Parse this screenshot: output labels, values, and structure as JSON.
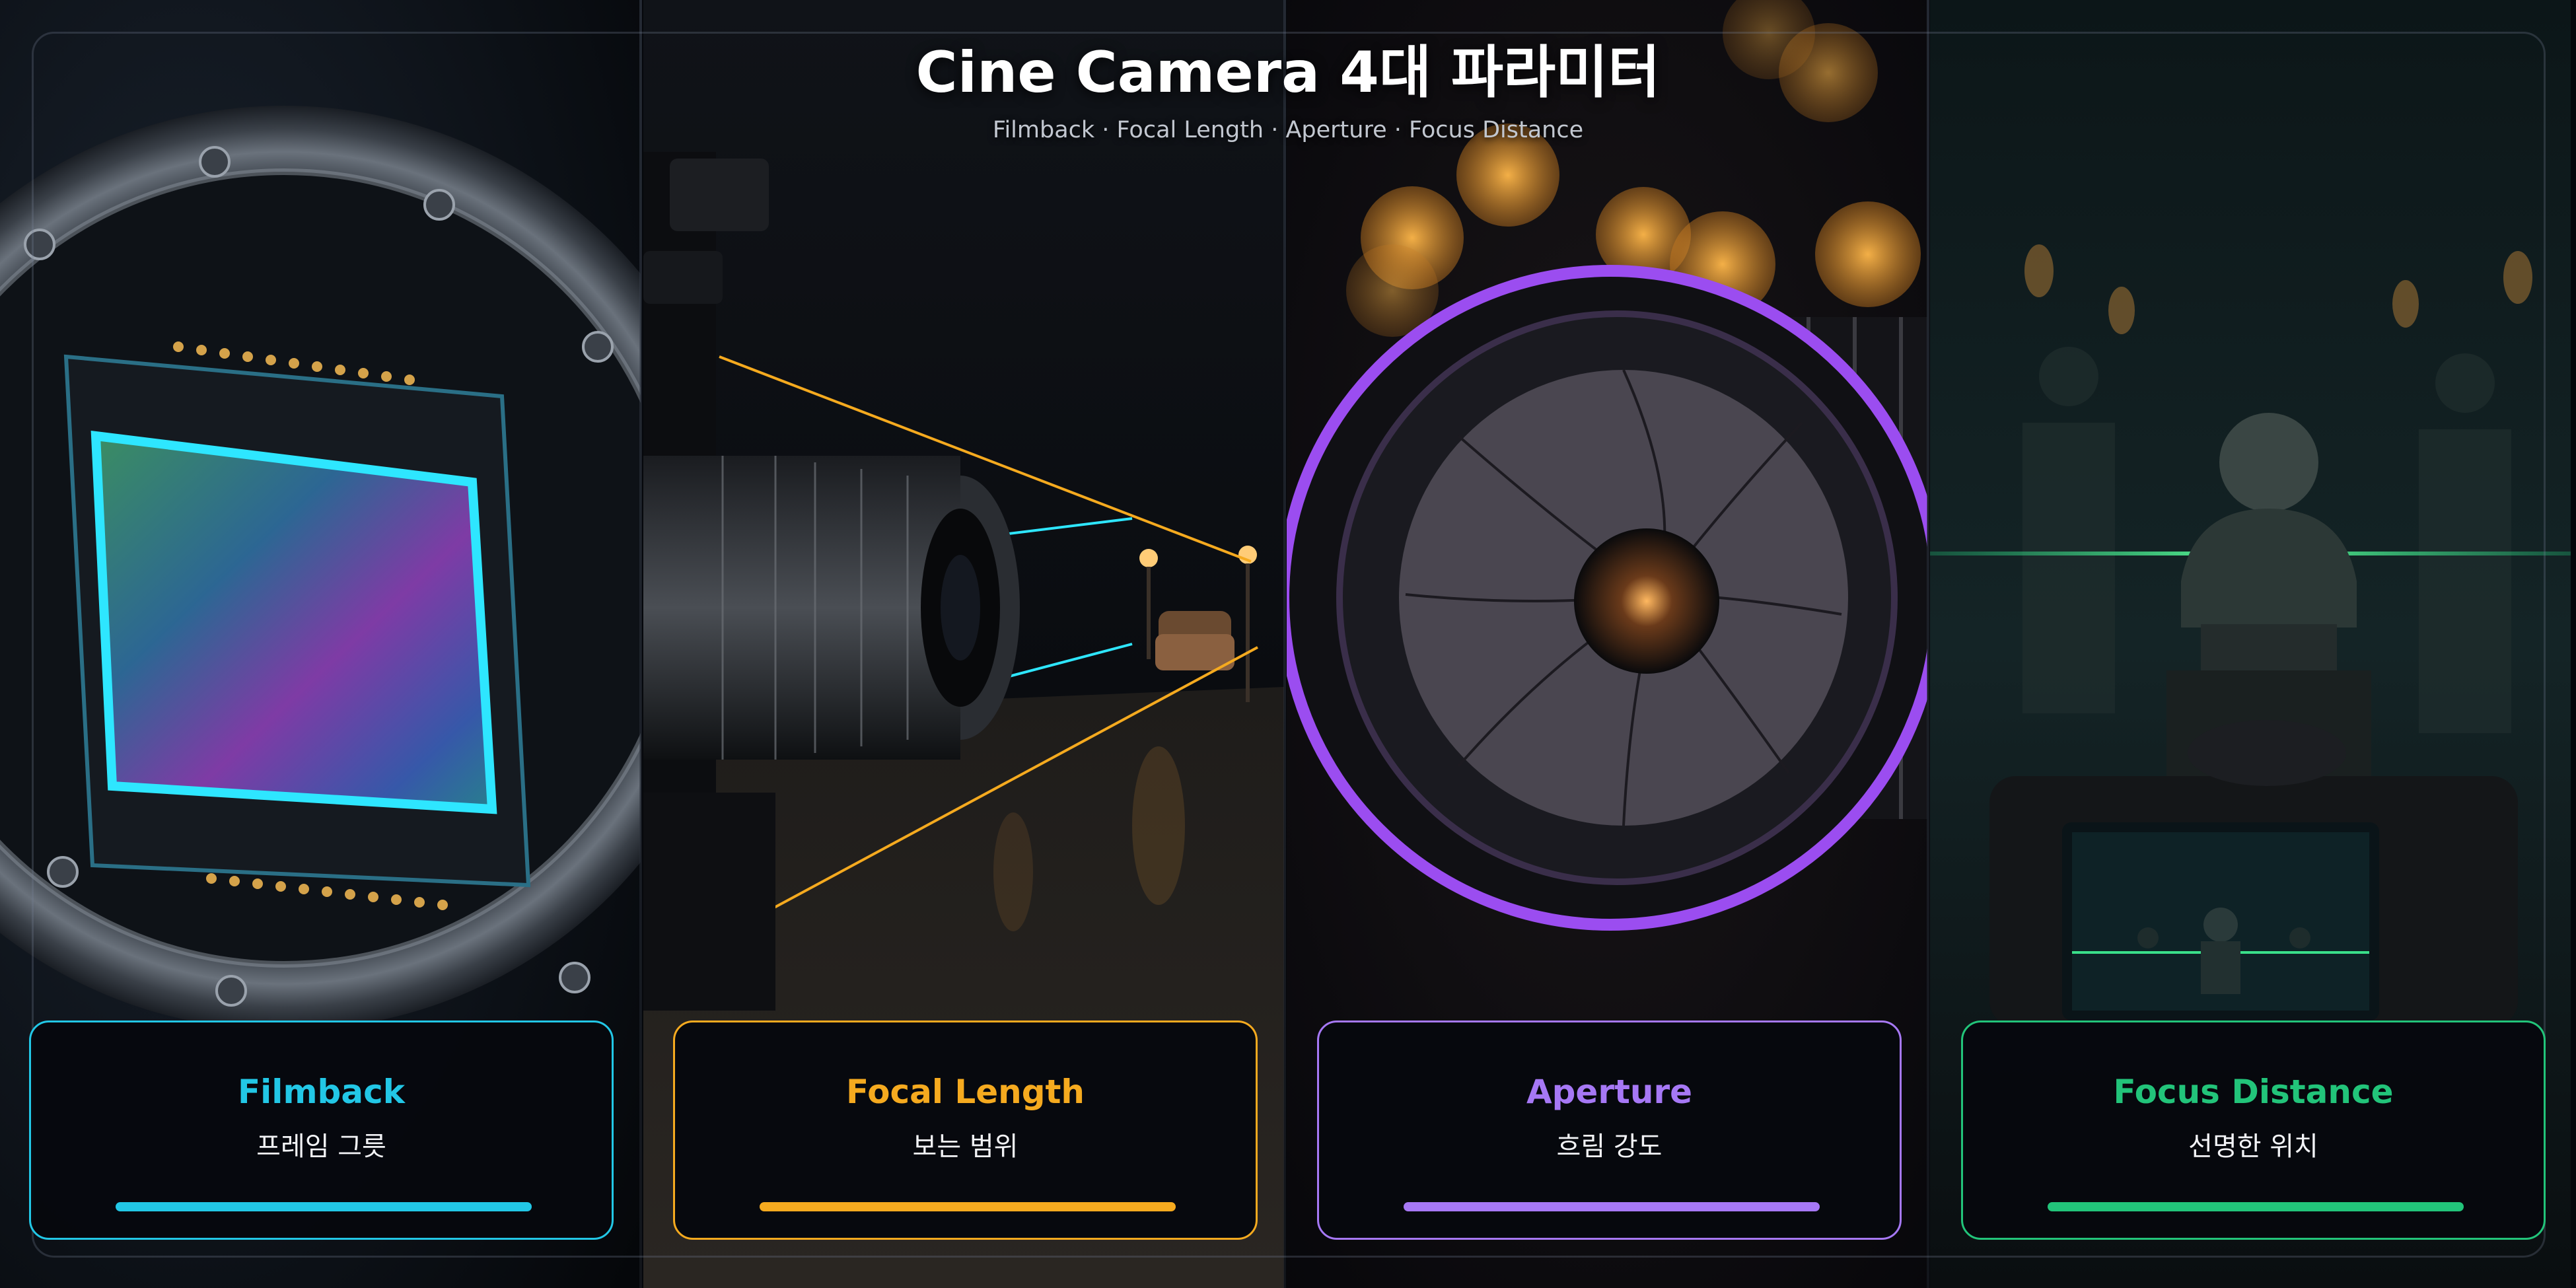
{
  "header": {
    "title": "Cine Camera 4대 파라미터",
    "subtitle": "Filmback · Focal Length · Aperture · Focus Distance"
  },
  "cards": [
    {
      "title": "Filmback",
      "subtitle": "프레임 그릇",
      "color": "#22c7e6"
    },
    {
      "title": "Focal Length",
      "subtitle": "보는 범위",
      "color": "#f5aa1f"
    },
    {
      "title": "Aperture",
      "subtitle": "흐림 강도",
      "color": "#a678f5"
    },
    {
      "title": "Focus Distance",
      "subtitle": "선명한 위치",
      "color": "#22c47a"
    }
  ]
}
